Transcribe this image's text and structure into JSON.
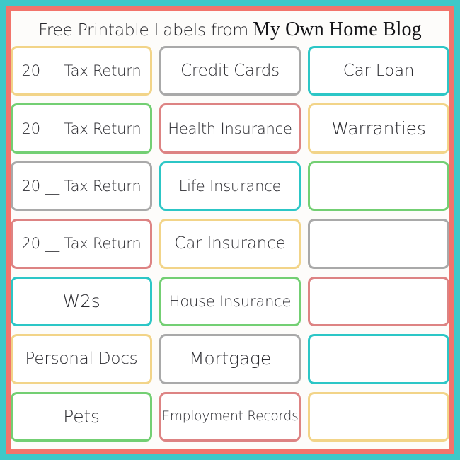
{
  "title": {
    "part_a": "Free Printable Labels from",
    "part_b": "My Own Home Blog"
  },
  "colors": {
    "outer_frame": "#3ec8c8",
    "inner_frame": "#f2746b",
    "paper": "#fdfcfa",
    "yellow": "#f2d488",
    "green": "#73cf73",
    "gray": "#a9a9a9",
    "red": "#dd8383",
    "cyan": "#2cc6c6",
    "text": "#2b2b30"
  },
  "grid": {
    "columns": 3,
    "rows": 7,
    "labels": [
      {
        "text": "20 __ Tax Return",
        "color": "yellow",
        "size": "md",
        "row": 1,
        "col": 1
      },
      {
        "text": "Credit Cards",
        "color": "gray",
        "size": "lg",
        "row": 1,
        "col": 2
      },
      {
        "text": "Car Loan",
        "color": "cyan",
        "size": "lg",
        "row": 1,
        "col": 3
      },
      {
        "text": "20 __ Tax Return",
        "color": "green",
        "size": "md",
        "row": 2,
        "col": 1
      },
      {
        "text": "Health Insurance",
        "color": "red",
        "size": "md",
        "row": 2,
        "col": 2
      },
      {
        "text": "Warranties",
        "color": "yellow",
        "size": "xl",
        "row": 2,
        "col": 3
      },
      {
        "text": "20 __ Tax Return",
        "color": "gray",
        "size": "md",
        "row": 3,
        "col": 1
      },
      {
        "text": "Life Insurance",
        "color": "cyan",
        "size": "md",
        "row": 3,
        "col": 2
      },
      {
        "text": "",
        "color": "green",
        "size": "md",
        "row": 3,
        "col": 3
      },
      {
        "text": "20 __ Tax Return",
        "color": "red",
        "size": "md",
        "row": 4,
        "col": 1
      },
      {
        "text": "Car Insurance",
        "color": "yellow",
        "size": "lg",
        "row": 4,
        "col": 2
      },
      {
        "text": "",
        "color": "gray",
        "size": "md",
        "row": 4,
        "col": 3
      },
      {
        "text": "W2s",
        "color": "cyan",
        "size": "xl",
        "row": 5,
        "col": 1
      },
      {
        "text": "House Insurance",
        "color": "green",
        "size": "md",
        "row": 5,
        "col": 2
      },
      {
        "text": "",
        "color": "red",
        "size": "md",
        "row": 5,
        "col": 3
      },
      {
        "text": "Personal Docs",
        "color": "yellow",
        "size": "lg",
        "row": 6,
        "col": 1
      },
      {
        "text": "Mortgage",
        "color": "gray",
        "size": "xl",
        "row": 6,
        "col": 2
      },
      {
        "text": "",
        "color": "cyan",
        "size": "md",
        "row": 6,
        "col": 3
      },
      {
        "text": "Pets",
        "color": "green",
        "size": "xl",
        "row": 7,
        "col": 1
      },
      {
        "text": "Employment Records",
        "color": "red",
        "size": "sm",
        "row": 7,
        "col": 2
      },
      {
        "text": "",
        "color": "yellow",
        "size": "md",
        "row": 7,
        "col": 3
      }
    ]
  }
}
